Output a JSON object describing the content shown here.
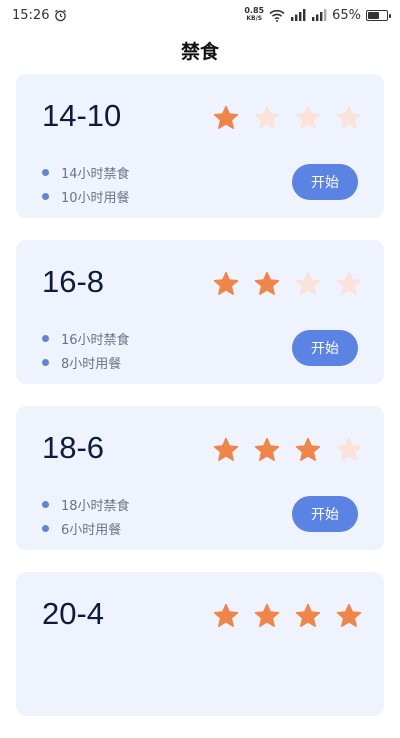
{
  "status_bar": {
    "time": "15:26",
    "net_speed": "0.85",
    "net_unit": "KB/S",
    "battery": "65%",
    "battery_level": 0.65
  },
  "header": {
    "title": "禁食"
  },
  "plans": [
    {
      "title": "14-10",
      "difficulty": 1,
      "max_difficulty": 4,
      "fasting": "14小时禁食",
      "eating": "10小时用餐",
      "button": "开始"
    },
    {
      "title": "16-8",
      "difficulty": 2,
      "max_difficulty": 4,
      "fasting": "16小时禁食",
      "eating": "8小时用餐",
      "button": "开始"
    },
    {
      "title": "18-6",
      "difficulty": 3,
      "max_difficulty": 4,
      "fasting": "18小时禁食",
      "eating": "6小时用餐",
      "button": "开始"
    },
    {
      "title": "20-4",
      "difficulty": 4,
      "max_difficulty": 4,
      "fasting": "",
      "eating": "",
      "button": ""
    }
  ],
  "colors": {
    "star_active": "#f0854a",
    "star_inactive": "#fbe3dc",
    "accent": "#5b83e3",
    "card_bg": "#eef3fd"
  }
}
